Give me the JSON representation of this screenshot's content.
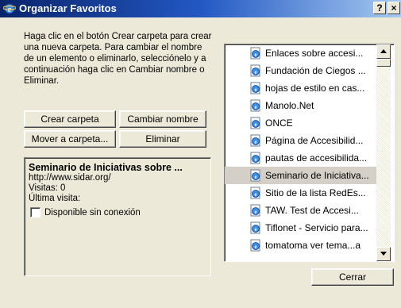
{
  "window": {
    "title": "Organizar Favoritos",
    "help_label": "?",
    "close_label": "×"
  },
  "instructions": "Haga clic en el botón Crear carpeta para crear una nueva carpeta. Para cambiar el nombre de un elemento o eliminarlo, selecciónelo y a continuación haga clic en Cambiar nombre o Eliminar.",
  "buttons": {
    "crear": {
      "label": "Crear carpeta"
    },
    "cambiar": {
      "label": "Cambiar nombre"
    },
    "mover": {
      "label": "Mover a carpeta..."
    },
    "eliminar": {
      "label": "Eliminar"
    },
    "cerrar": {
      "label": "Cerrar"
    }
  },
  "details": {
    "title": "Seminario de Iniciativas sobre ...",
    "url": "http://www.sidar.org/",
    "visits": "Visitas: 0",
    "last_visit": "Última visita:",
    "offline_label": "Disponible sin conexión",
    "offline_checked": false
  },
  "favorites": [
    {
      "label": "Enlaces sobre accesi...",
      "icon": "ie-page-icon",
      "selected": false
    },
    {
      "label": "Fundación de Ciegos ...",
      "icon": "ie-page-icon",
      "selected": false
    },
    {
      "label": "hojas de estilo en cas...",
      "icon": "ie-page-icon",
      "selected": false
    },
    {
      "label": "Manolo.Net",
      "icon": "ie-page-icon",
      "selected": false
    },
    {
      "label": "ONCE",
      "icon": "ie-page-icon",
      "selected": false
    },
    {
      "label": "Página de Accesibilid...",
      "icon": "ie-page-icon",
      "selected": false
    },
    {
      "label": "pautas de accesibilida...",
      "icon": "ie-page-icon",
      "selected": false
    },
    {
      "label": "Seminario de Iniciativa...",
      "icon": "ie-page-icon",
      "selected": true
    },
    {
      "label": "Sitio de la lista RedEs...",
      "icon": "ie-page-icon",
      "selected": false
    },
    {
      "label": "TAW. Test de Accesi...",
      "icon": "ie-page-icon",
      "selected": false
    },
    {
      "label": "Tiflonet - Servicio para...",
      "icon": "ie-page-icon",
      "selected": false
    },
    {
      "label": "tomatoma ver tema...a",
      "icon": "ie-page-icon",
      "selected": false
    }
  ],
  "colors": {
    "titlebar_start": "#0a246a",
    "titlebar_end": "#a6caf0",
    "dialog_bg": "#ece9d8",
    "selected_bg": "#d4d0c8"
  }
}
